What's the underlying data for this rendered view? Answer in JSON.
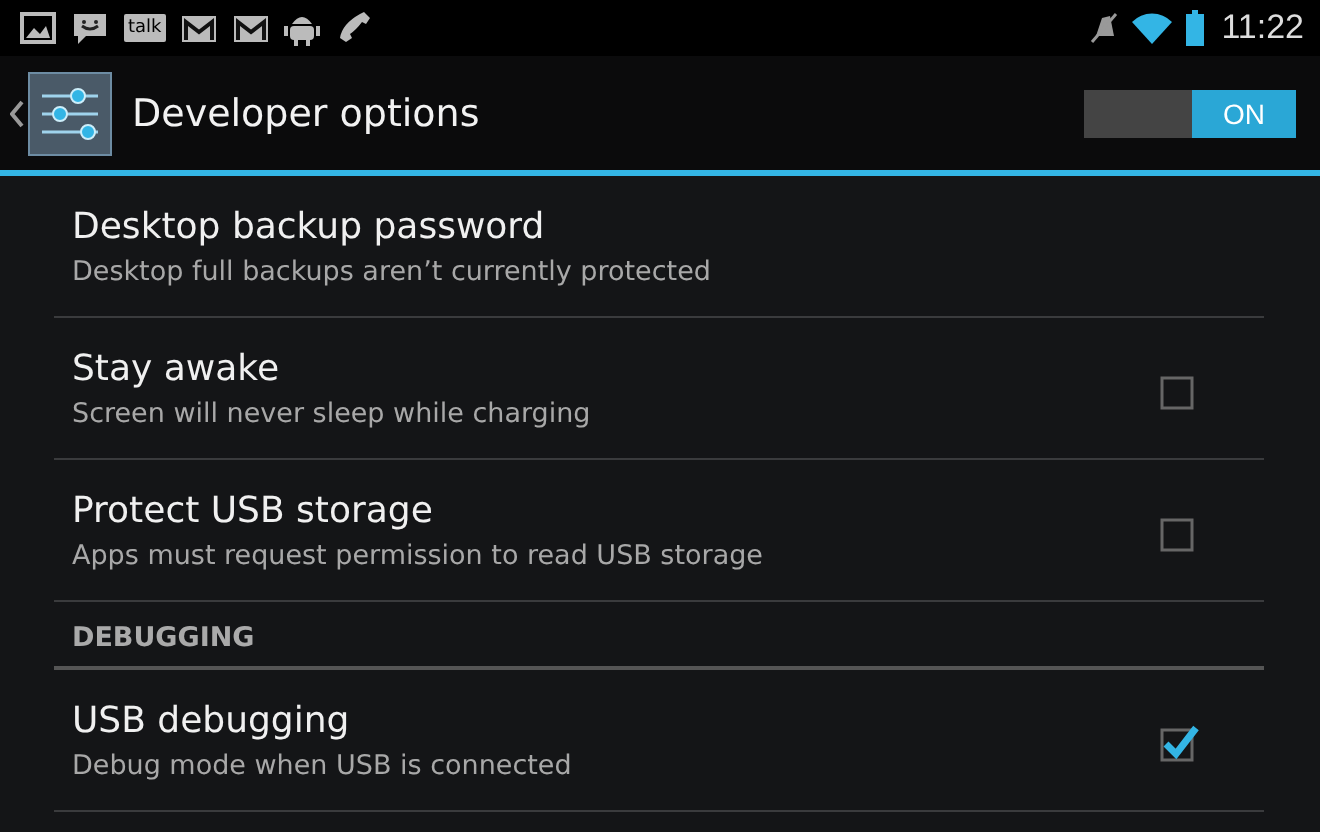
{
  "status_bar": {
    "notifications": [
      {
        "kind": "picture"
      },
      {
        "kind": "message"
      },
      {
        "kind": "talk",
        "label": "talk"
      },
      {
        "kind": "mail"
      },
      {
        "kind": "mail"
      },
      {
        "kind": "robot"
      },
      {
        "kind": "phone"
      }
    ],
    "time": "11:22"
  },
  "action_bar": {
    "title": "Developer options",
    "switch": {
      "label": "ON",
      "on": true
    }
  },
  "items": [
    {
      "kind": "plain",
      "title": "Desktop backup password",
      "summary": "Desktop full backups aren’t currently protected"
    },
    {
      "kind": "checkbox",
      "title": "Stay awake",
      "summary": "Screen will never sleep while charging",
      "checked": false
    },
    {
      "kind": "checkbox",
      "title": "Protect USB storage",
      "summary": "Apps must request permission to read USB storage",
      "checked": false
    },
    {
      "kind": "header",
      "title": "DEBUGGING"
    },
    {
      "kind": "checkbox",
      "title": "USB debugging",
      "summary": "Debug mode when USB is connected",
      "checked": true
    }
  ]
}
